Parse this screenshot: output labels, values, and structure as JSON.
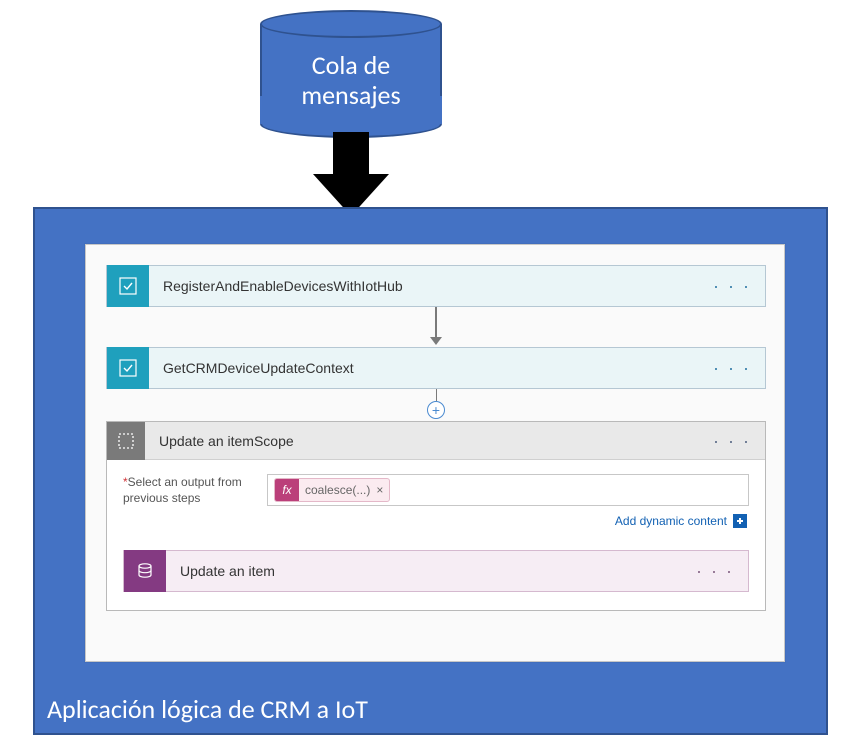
{
  "cylinder": {
    "line1": "Cola de",
    "line2": "mensajes"
  },
  "container": {
    "title": "Aplicación lógica de CRM a IoT"
  },
  "steps": {
    "step1": "RegisterAndEnableDevicesWithIotHub",
    "step2": "GetCRMDeviceUpdateContext"
  },
  "scope": {
    "header": "Update an itemScope",
    "fieldAsterisk": "*",
    "fieldLabel": "Select an output from previous steps",
    "pillIcon": "fx",
    "pillText": "coalesce(...)",
    "pillClose": "×",
    "addDynamic": "Add dynamic content",
    "innerStep": "Update an item"
  },
  "glyphs": {
    "dots": "· · ·",
    "plus": "+"
  }
}
